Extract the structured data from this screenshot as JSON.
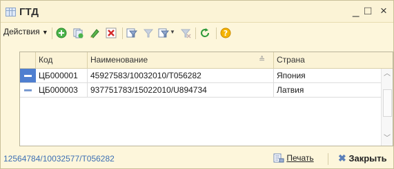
{
  "window": {
    "title": "ГТД"
  },
  "toolbar": {
    "actions_label": "Действия"
  },
  "table": {
    "columns": [
      "Код",
      "Наименование",
      "Страна"
    ],
    "rows": [
      {
        "code": "ЦБ000001",
        "name": "45927583/10032010/Т056282",
        "country": "Япония"
      },
      {
        "code": "ЦБ000003",
        "name": "937751783/15022010/U894734",
        "country": "Латвия"
      }
    ]
  },
  "status": {
    "text": "12564784/10032577/Т056282"
  },
  "buttons": {
    "print": "Печать",
    "close": "Закрыть"
  },
  "colors": {
    "accent_blue": "#3c6fb4",
    "row_selected": "#4f7fd0",
    "window_bg": "#fdf6db"
  }
}
